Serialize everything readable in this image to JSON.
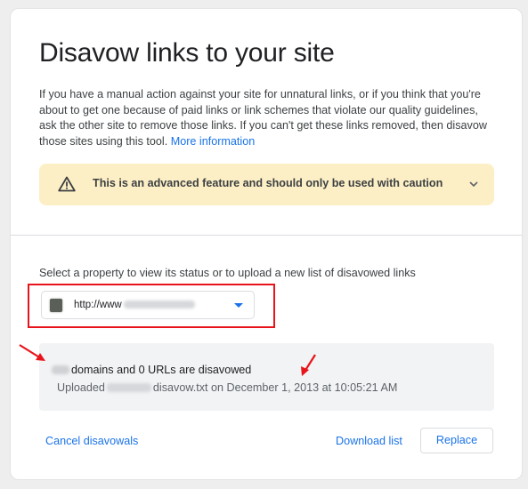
{
  "page": {
    "title": "Disavow links to your site",
    "intro_text": "If you have a manual action against your site for unnatural links, or if you think that you're about to get one because of paid links or link schemes that violate our quality guidelines, ask the other site to remove those links. If you can't get these links removed, then disavow those sites using this tool.",
    "more_info_link": "More information"
  },
  "caution": {
    "icon": "warning-triangle-icon",
    "text": "This is an advanced feature and should only be used with caution",
    "expand_icon": "chevron-down-icon"
  },
  "property_selector": {
    "label": "Select a property to view its status or to upload a new list of disavowed links",
    "selected_value_prefix": "http://www",
    "favicon_icon": "site-favicon-icon",
    "dropdown_icon": "caret-down-icon"
  },
  "status": {
    "count_suffix": "domains and 0 URLs are disavowed",
    "uploaded_prefix": "Uploaded",
    "uploaded_suffix": "disavow.txt on December 1, 2013 at 10:05:21 AM"
  },
  "actions": {
    "cancel_label": "Cancel disavowals",
    "download_label": "Download list",
    "replace_label": "Replace"
  },
  "colors": {
    "accent": "#1a73e8",
    "caution_bg": "#fdefc5",
    "annotation_red": "#e8141b",
    "status_bg": "#f1f3f4"
  }
}
